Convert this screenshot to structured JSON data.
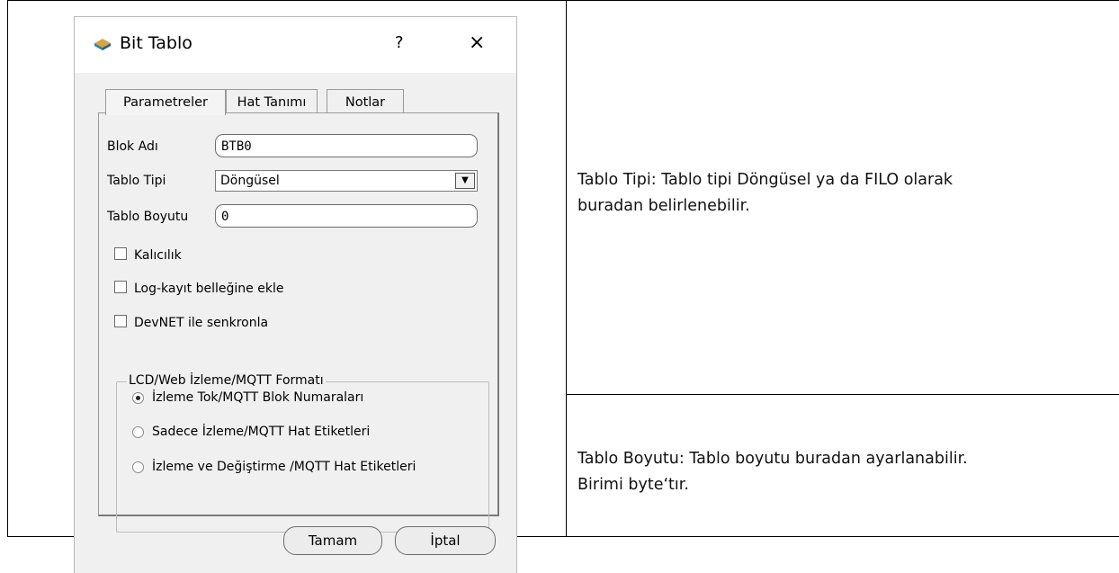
{
  "dialog": {
    "title": "Bit Tablo",
    "help": "?",
    "close": "×",
    "tabs": [
      "Parametreler",
      "Hat Tanımı",
      "Notlar"
    ],
    "fields": {
      "block_name_label": "Blok Adı",
      "block_name_value": "BTB0",
      "table_type_label": "Tablo Tipi",
      "table_type_value": "Döngüsel",
      "table_size_label": "Tablo Boyutu",
      "table_size_value": "0"
    },
    "checkboxes": [
      "Kalıcılık",
      "Log-kayıt belleğine ekle",
      "DevNET ile senkronla"
    ],
    "group": {
      "legend": "LCD/Web İzleme/MQTT Formatı",
      "options": [
        "İzleme Tok/MQTT Blok Numaraları",
        "Sadece İzleme/MQTT Hat Etiketleri",
        "İzleme ve Değiştirme /MQTT Hat Etiketleri"
      ],
      "selected_index": 0
    },
    "buttons": {
      "ok": "Tamam",
      "cancel": "İptal"
    }
  },
  "descriptions": {
    "table_type_line1": "Tablo Tipi:  Tablo tipi Döngüsel ya da FILO olarak",
    "table_type_line2": "buradan belirlenebilir.",
    "table_size_line1": "Tablo Boyutu: Tablo boyutu buradan ayarlanabilir.",
    "table_size_line2": "Birimi byte‘tır."
  }
}
